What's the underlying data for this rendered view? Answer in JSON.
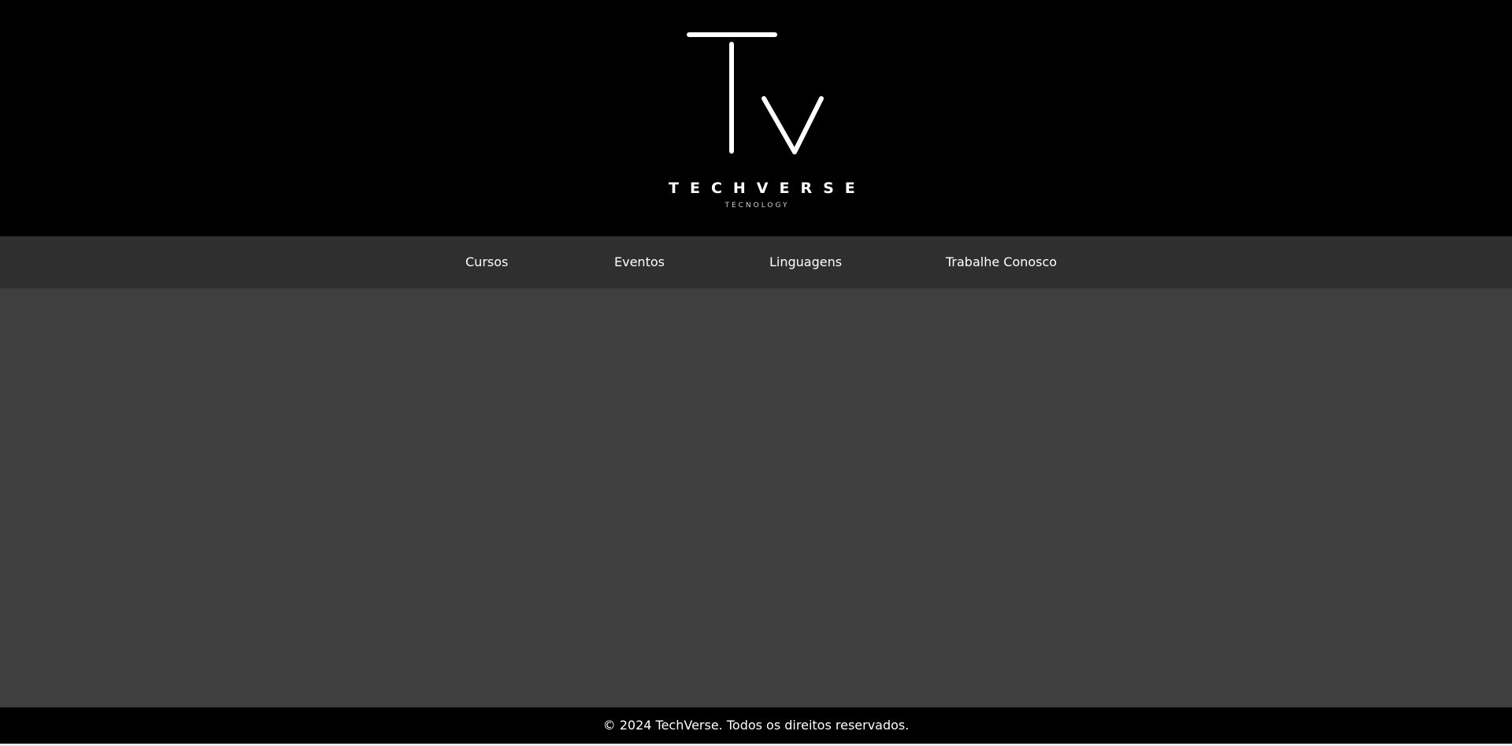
{
  "header": {
    "logo": {
      "monogram": "Tv",
      "wordmark": "TECHVERSE",
      "tagline": "TECNOLOGY"
    }
  },
  "nav": {
    "items": [
      {
        "label": "Cursos"
      },
      {
        "label": "Eventos"
      },
      {
        "label": "Linguagens"
      },
      {
        "label": "Trabalhe Conosco"
      }
    ]
  },
  "footer": {
    "text": "© 2024 TechVerse. Todos os direitos reservados."
  },
  "colors": {
    "header_bg": "#000000",
    "nav_bg": "#2f2f2f",
    "main_bg": "#3f3f3f",
    "footer_bg": "#000000",
    "text": "#ffffff"
  }
}
